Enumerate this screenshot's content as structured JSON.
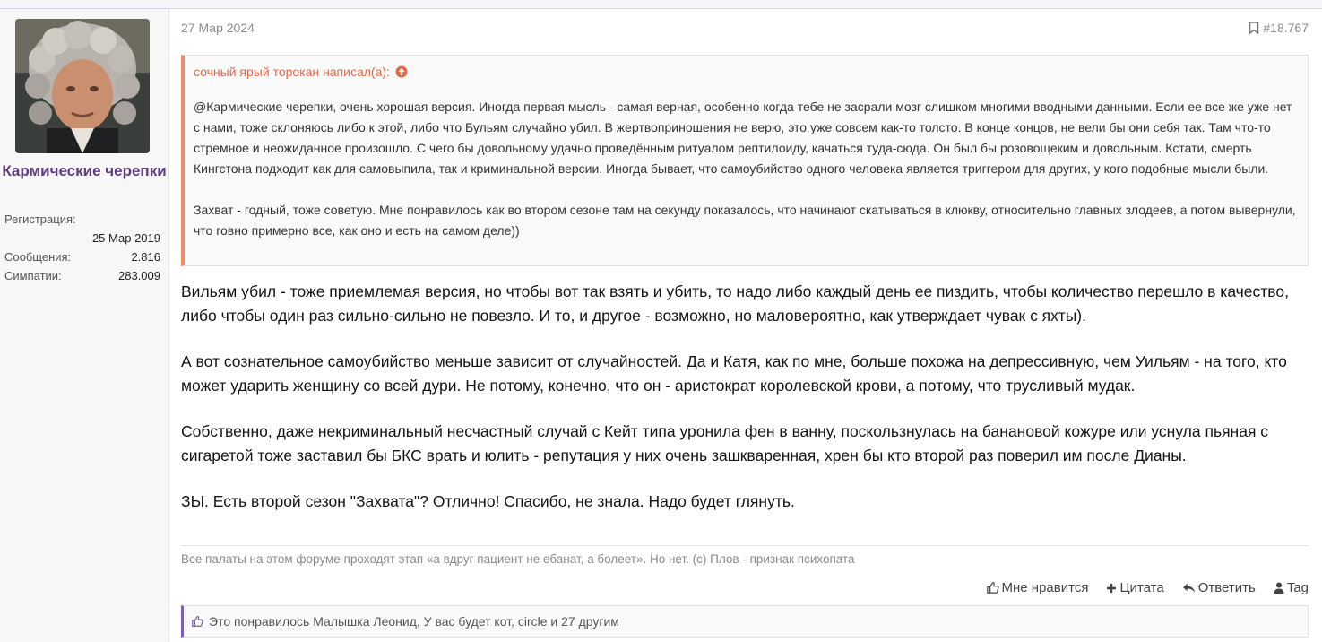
{
  "post": {
    "date": "27 Мар 2024",
    "number": "#18.767",
    "author": {
      "name": "Кармические черепки",
      "stats": [
        {
          "label": "Регистрация:",
          "value": ""
        },
        {
          "label": "",
          "value": "25 Мар 2019"
        },
        {
          "label": "Сообщения:",
          "value": "2.816"
        },
        {
          "label": "Симпатии:",
          "value": "283.009"
        }
      ]
    },
    "quote": {
      "header": "сочный ярый торокан написал(а):",
      "paragraphs": [
        "@Кармические черепки, очень хорошая версия. Иногда первая мысль - самая верная, особенно когда тебе не засрали мозг слишком многими вводными данными. Если ее все же уже нет с нами, тоже склоняюсь либо к этой, либо что Бульям случайно убил. В жертвоприношения не верю, это уже совсем как-то толсто. В конце концов, не вели бы они себя так. Там что-то стремное и неожиданное произошло. С чего бы довольному удачно проведённым ритуалом рептилоиду, качаться туда-сюда. Он был бы розовощеким и довольным. Кстати, смерть Кингстона подходит как для самовыпила, так и криминальной версии. Иногда бывает, что самоубийство одного человека является триггером для других, у кого подобные мысли были.",
        "Захват - годный, тоже советую. Мне понравилось как во втором сезоне там на секунду показалось, что начинают скатываться в клюкву, относительно главных злодеев, а потом вывернули, что говно примерно все, как оно и есть на самом деле))"
      ]
    },
    "body": [
      "Вильям убил - тоже приемлемая версия, но чтобы вот так взять и убить, то надо либо каждый день ее пиздить, чтобы количество перешло в качество, либо чтобы один раз сильно-сильно не повезло. И то, и другое - возможно, но маловероятно, как утверждает чувак с яхты).",
      "А вот сознательное самоубийство меньше зависит от случайностей. Да и Катя, как по мне, больше похожа на депрессивную, чем Уильям - на того, кто может ударить женщину со всей дури. Не потому, конечно, что он - аристократ королевской крови, а потому, что трусливый мудак.",
      "Собственно, даже некриминальный несчастный случай с Кейт типа уронила фен в ванну, поскользнулась на банановой кожуре или уснула пьяная с сигаретой тоже заставил бы БКС врать и юлить - репутация у них очень зашкваренная, хрен бы кто второй раз поверил им после Дианы.",
      "ЗЫ. Есть второй сезон \"Захвата\"? Отлично! Спасибо, не знала. Надо будет глянуть."
    ],
    "signature": "Все палаты на этом форуме проходят этап «а вдруг пациент не ебанат, а болеет». Но нет. (с) Плов - признак психопата",
    "actions": {
      "like": "Мне нравится",
      "quote": "Цитата",
      "reply": "Ответить",
      "tag": "Tag"
    },
    "likes_text": "Это понравилось Малышка Леонид, У вас будет кот, circle и 27 другим"
  },
  "colors": {
    "username": "#5c3d80",
    "quote_accent": "#f08c6c",
    "quote_header": "#e56a48",
    "likes_accent": "#7b5fb0"
  }
}
